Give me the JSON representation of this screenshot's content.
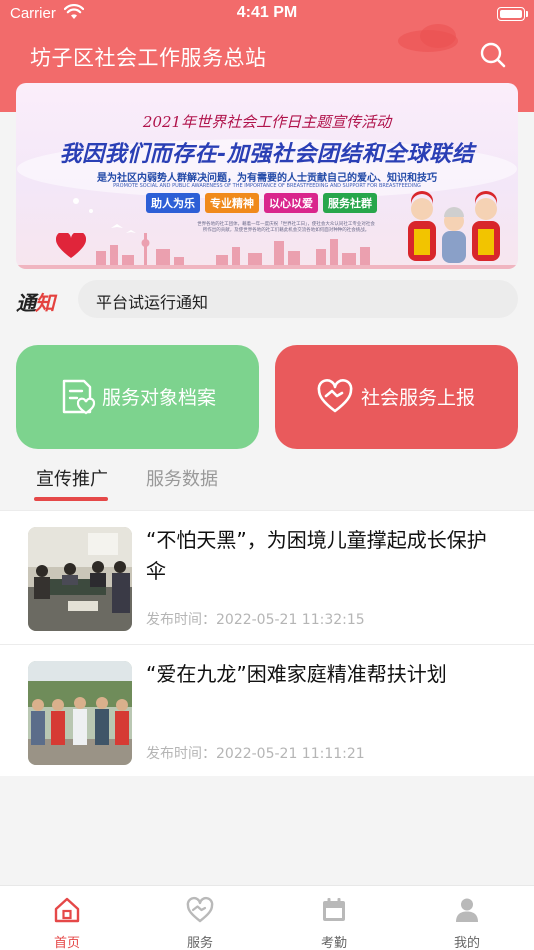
{
  "status_bar": {
    "carrier": "Carrier",
    "time": "4:41 PM",
    "icons": [
      "wifi-icon",
      "battery-icon"
    ]
  },
  "header": {
    "title": "坊子区社会工作服务总站",
    "search_icon": "search-icon",
    "background_color": "#f26b6b"
  },
  "banner": {
    "line1": "2021年世界社会工作日主题宣传活动",
    "line2": "我因我们而存在-加强社会团结和全球联结",
    "line3": "是为社区内弱势人群解决问题，为有需要的人士贡献自己的爱心、知识和技巧",
    "line4": "PROMOTE SOCIAL AND PUBLIC AWARENESS OF THE IMPORTANCE OF BREASTFEEDING AND SUPPORT FOR BREASTFEEDING",
    "tags": [
      {
        "label": "助人为乐",
        "color": "#2d5fd6"
      },
      {
        "label": "专业精神",
        "color": "#f08a1c"
      },
      {
        "label": "以心以爱",
        "color": "#d9268c"
      },
      {
        "label": "服务社群",
        "color": "#27a64b"
      }
    ],
    "small_text": "世界各地的社工团体，藉着一年一度庆祝「世界社工日」，使社会大众认同社工专业对社会所作出的贡献，及使世界各地的社工们藉此机会交流各地如何面对种种的社会挑战。"
  },
  "notice": {
    "tag_part1": "通",
    "tag_part2": "知",
    "text": "平台试运行通知"
  },
  "actions": {
    "left": {
      "label": "服务对象档案",
      "icon": "profile-document-icon",
      "color": "#7dd38e"
    },
    "right": {
      "label": "社会服务上报",
      "icon": "heart-hands-icon",
      "color": "#e95a5c"
    }
  },
  "tabs": [
    {
      "label": "宣传推广",
      "active": true
    },
    {
      "label": "服务数据",
      "active": false
    }
  ],
  "articles": [
    {
      "title": "“不怕天黑”，为困境儿童撑起成长保护伞",
      "date_label": "发布时间：",
      "date": "2022-05-21 11:32:15",
      "thumb": "meeting-photo"
    },
    {
      "title": "“爱在九龙”困难家庭精准帮扶计划",
      "date_label": "发布时间：",
      "date": "2022-05-21 11:11:21",
      "thumb": "volunteers-photo"
    }
  ],
  "tabbar": {
    "items": [
      {
        "label": "首页",
        "icon": "home-icon",
        "active": true
      },
      {
        "label": "服务",
        "icon": "heart-hands-icon",
        "active": false
      },
      {
        "label": "考勤",
        "icon": "calendar-icon",
        "active": false
      },
      {
        "label": "我的",
        "icon": "user-icon",
        "active": false
      }
    ],
    "active_color": "#e54848"
  }
}
